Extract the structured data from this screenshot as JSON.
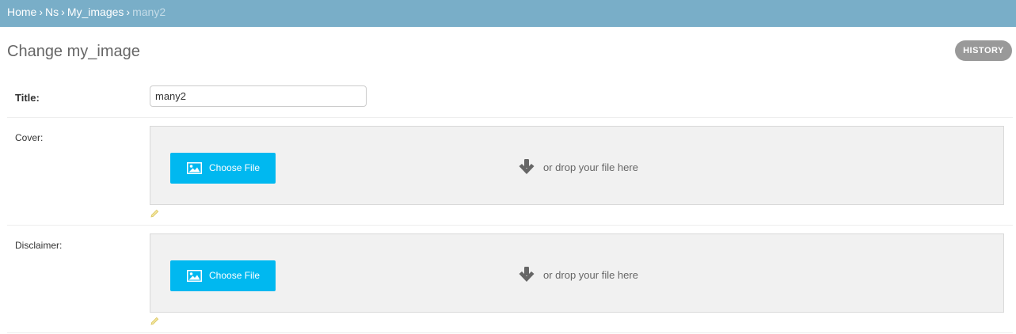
{
  "breadcrumbs": {
    "items": [
      "Home",
      "Ns",
      "My_images"
    ],
    "current": "many2",
    "separator": "›"
  },
  "page": {
    "title": "Change my_image",
    "history_label": "HISTORY"
  },
  "form": {
    "title_label": "Title:",
    "title_value": "many2",
    "cover_label": "Cover:",
    "disclaimer_label": "Disclaimer:",
    "choose_file_label": "Choose File",
    "drop_hint": "or drop your file here"
  },
  "colors": {
    "header_bg": "#79aec8",
    "choose_button": "#00b8f0",
    "history_button": "#999999",
    "dropzone_bg": "#f1f1f1"
  },
  "icons": {
    "choose_file": "image-icon",
    "drop": "arrow-down-icon",
    "edit": "pencil-icon"
  }
}
